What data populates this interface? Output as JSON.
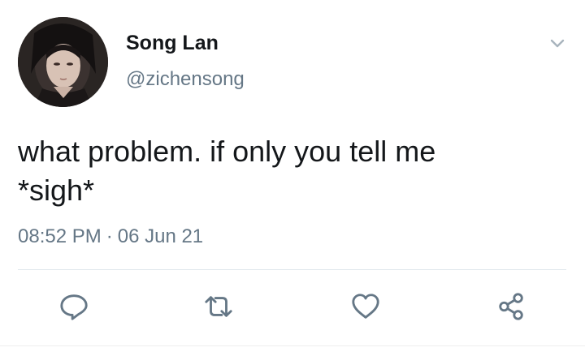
{
  "tweet": {
    "author_name": "Song Lan",
    "author_handle": "@zichensong",
    "text_line1": "what problem. if only you tell me",
    "text_line2": "*sigh*",
    "time": "08:52 PM",
    "separator": "·",
    "date": "06 Jun 21"
  },
  "icons": {
    "menu": "chevron-down-icon",
    "reply": "reply-icon",
    "retweet": "retweet-icon",
    "like": "heart-icon",
    "share": "share-icon"
  },
  "colors": {
    "text_primary": "#14171a",
    "text_secondary": "#657786",
    "icon": "#657786",
    "divider": "#e1e8ed"
  }
}
